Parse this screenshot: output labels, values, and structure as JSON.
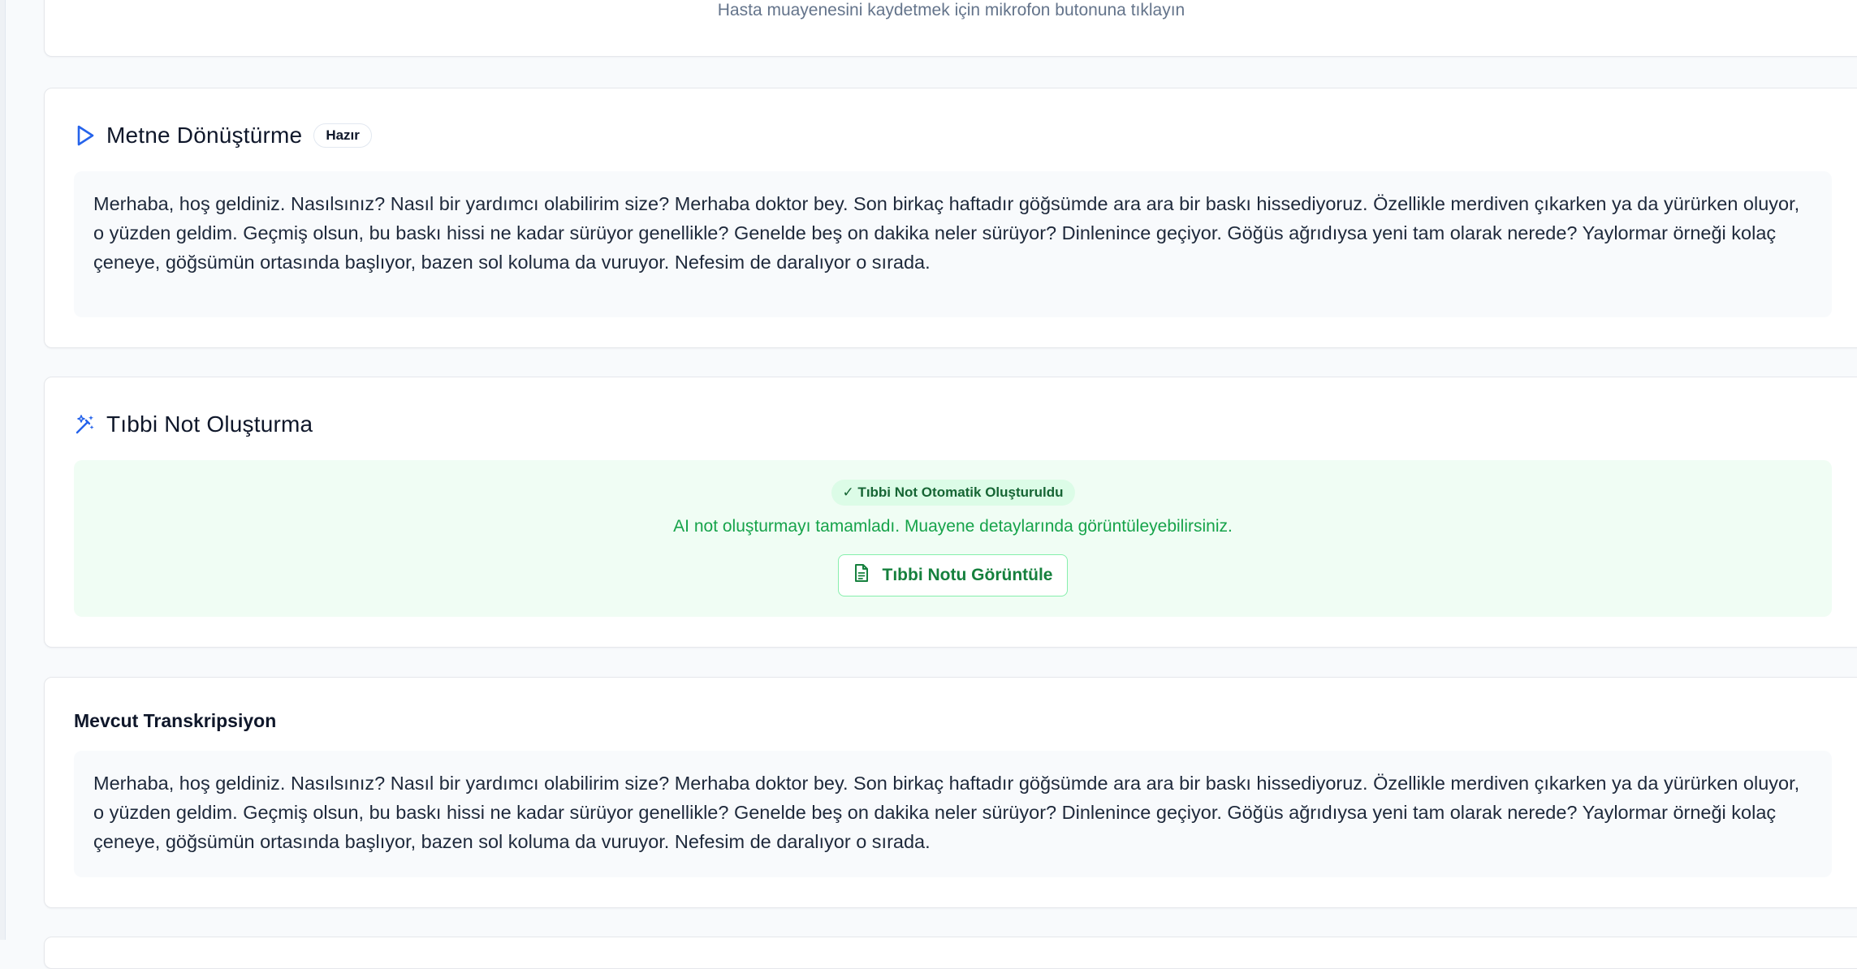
{
  "recorder": {
    "hint": "Hasta muayenesini kaydetmek için mikrofon butonuna tıklayın"
  },
  "transcription_section": {
    "title": "Metne Dönüştürme",
    "badge": "Hazır",
    "icon": "play-icon",
    "text": "Merhaba, hoş geldiniz. Nasılsınız? Nasıl bir yardımcı olabilirim size? Merhaba doktor bey. Son birkaç haftadır göğsümde ara ara bir baskı hissediyoruz. Özellikle merdiven çıkarken ya da yürürken oluyor, o yüzden geldim. Geçmiş olsun, bu baskı hissi ne kadar sürüyor genellikle? Genelde beş on dakika neler sürüyor? Dinlenince geçiyor. Göğüs ağrıdıysa yeni tam olarak nerede? Yaylormar örneği kolaç çeneye, göğsümün ortasında başlıyor, bazen sol koluma da vuruyor. Nefesim de daralıyor o sırada."
  },
  "note_section": {
    "title": "Tıbbi Not Oluşturma",
    "icon": "magic-wand-icon",
    "status_pill": "✓ Tıbbi Not Otomatik Oluşturuldu",
    "message": "AI not oluşturmayı tamamladı. Muayene detaylarında görüntüleyebilirsiniz.",
    "button_label": "Tıbbi Notu Görüntüle",
    "button_icon": "document-icon"
  },
  "current_transcription": {
    "title": "Mevcut Transkripsiyon",
    "text": "Merhaba, hoş geldiniz. Nasılsınız? Nasıl bir yardımcı olabilirim size? Merhaba doktor bey. Son birkaç haftadır göğsümde ara ara bir baskı hissediyoruz. Özellikle merdiven çıkarken ya da yürürken oluyor, o yüzden geldim. Geçmiş olsun, bu baskı hissi ne kadar sürüyor genellikle? Genelde beş on dakika neler sürüyor? Dinlenince geçiyor. Göğüs ağrıdıysa yeni tam olarak nerede? Yaylormar örneği kolaç çeneye, göğsümün ortasında başlıyor, bazen sol koluma da vuruyor. Nefesim de daralıyor o sırada."
  },
  "colors": {
    "accent": "#2563eb",
    "success_bg": "#f0fdf4",
    "success_text": "#16a34a",
    "success_pill_bg": "#dcfce7"
  }
}
